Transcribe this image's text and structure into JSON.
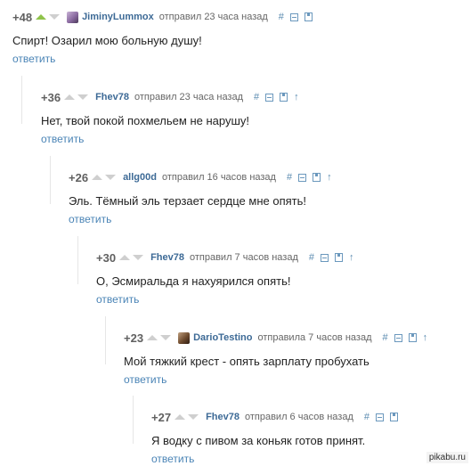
{
  "actions": {
    "reply_label": "ответить",
    "anchor_glyph": "#",
    "parent_glyph": "↑"
  },
  "comments": [
    {
      "rating": "+48",
      "user": "JiminyLummox",
      "meta": "отправил 23 часа назад",
      "text": "Спирт! Озарил мою больную душу!",
      "upvoted": true,
      "avatar": "user-avatar"
    },
    {
      "rating": "+36",
      "user": "Fhev78",
      "meta": "отправил 23 часа назад",
      "text": "Нет, твой покой похмельем не нарушу!",
      "upvoted": false,
      "avatar": ""
    },
    {
      "rating": "+26",
      "user": "allg00d",
      "meta": "отправил 16 часов назад",
      "text": "Эль. Тёмный эль терзает сердце мне опять!",
      "upvoted": false,
      "avatar": ""
    },
    {
      "rating": "+30",
      "user": "Fhev78",
      "meta": "отправил 7 часов назад",
      "text": "О, Эсмиральда я нахуярился опять!",
      "upvoted": false,
      "avatar": ""
    },
    {
      "rating": "+23",
      "user": "DarioTestino",
      "meta": "отправила 7 часов назад",
      "text": "Мой тяжкий крест - опять зарплату пробухать",
      "upvoted": false,
      "avatar": "user-avatar"
    },
    {
      "rating": "+27",
      "user": "Fhev78",
      "meta": "отправил 6 часов назад",
      "text": "Я водку с пивом за коньяк готов принят.",
      "upvoted": false,
      "avatar": ""
    }
  ],
  "watermark": "pikabu.ru"
}
